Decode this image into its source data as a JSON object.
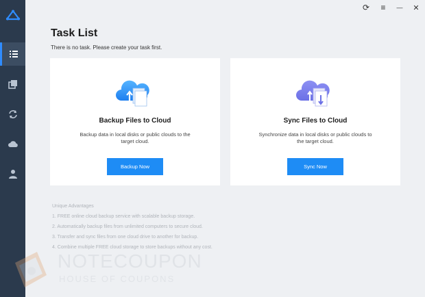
{
  "sidebar": {
    "items": [
      {
        "name": "task-list",
        "icon": "list-icon",
        "active": true
      },
      {
        "name": "clone",
        "icon": "copy-icon",
        "active": false
      },
      {
        "name": "sync",
        "icon": "sync-icon",
        "active": false
      },
      {
        "name": "cloud",
        "icon": "cloud-icon",
        "active": false
      },
      {
        "name": "account",
        "icon": "user-icon",
        "active": false
      }
    ]
  },
  "titlebar": {
    "refresh": "⟳",
    "menu": "≡",
    "minimize": "—",
    "close": "✕"
  },
  "main": {
    "title": "Task List",
    "subtitle": "There is no task. Please create your task first."
  },
  "cards": [
    {
      "title": "Backup Files to Cloud",
      "description": "Backup data in local disks or public clouds to the target cloud.",
      "button": "Backup Now"
    },
    {
      "title": "Sync Files to Cloud",
      "description": "Synchronize data in local disks or public clouds to the target cloud.",
      "button": "Sync Now"
    }
  ],
  "advantages": {
    "title": "Unique Advantages",
    "items": [
      "1. FREE online cloud backup service with scalable backup storage.",
      "2. Automatically backup files from unlimited computers to secure cloud.",
      "3. Transfer and sync files from one cloud drive to another for backup.",
      "4. Combine multiple FREE cloud storage to store backups without any cost."
    ]
  },
  "watermark": {
    "title": "NOTECOUPON",
    "subtitle": "HOUSE OF COUPONS"
  },
  "colors": {
    "sidebar": "#2b3a4d",
    "accent": "#1e8cf5",
    "background": "#eef0f3"
  }
}
